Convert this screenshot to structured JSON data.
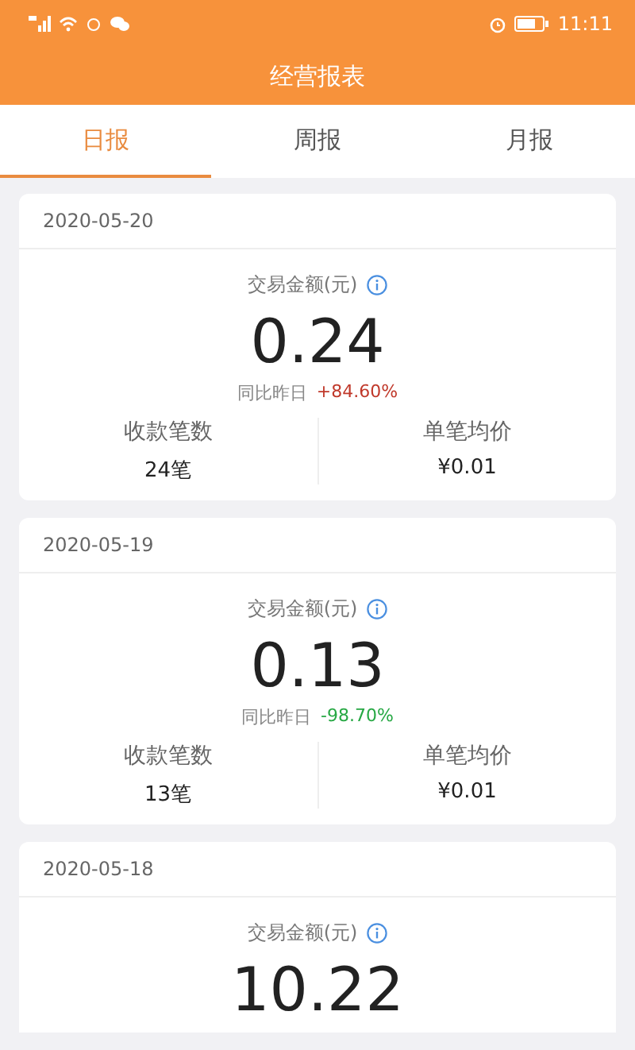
{
  "status_bar": {
    "time": "11:11"
  },
  "header": {
    "title": "经营报表"
  },
  "tabs": [
    {
      "label": "日报",
      "selected": true
    },
    {
      "label": "周报",
      "selected": false
    },
    {
      "label": "月报",
      "selected": false
    }
  ],
  "reports": [
    {
      "date": "2020-05-20",
      "amount_label": "交易金额(元)",
      "amount": "0.24",
      "compare_label": "同比昨日",
      "change": "+84.60%",
      "color": "#c0392b",
      "count_label": "收款笔数",
      "count": "24笔",
      "avg_label": "单笔均价",
      "avg": "¥0.01"
    },
    {
      "date": "2020-05-19",
      "amount_label": "交易金额(元)",
      "amount": "0.13",
      "compare_label": "同比昨日",
      "change": "-98.70%",
      "color": "#27a844",
      "count_label": "收款笔数",
      "count": "13笔",
      "avg_label": "单笔均价",
      "avg": "¥0.01"
    },
    {
      "date": "2020-05-18",
      "amount_label": "交易金额(元)",
      "amount": "10.22"
    }
  ]
}
